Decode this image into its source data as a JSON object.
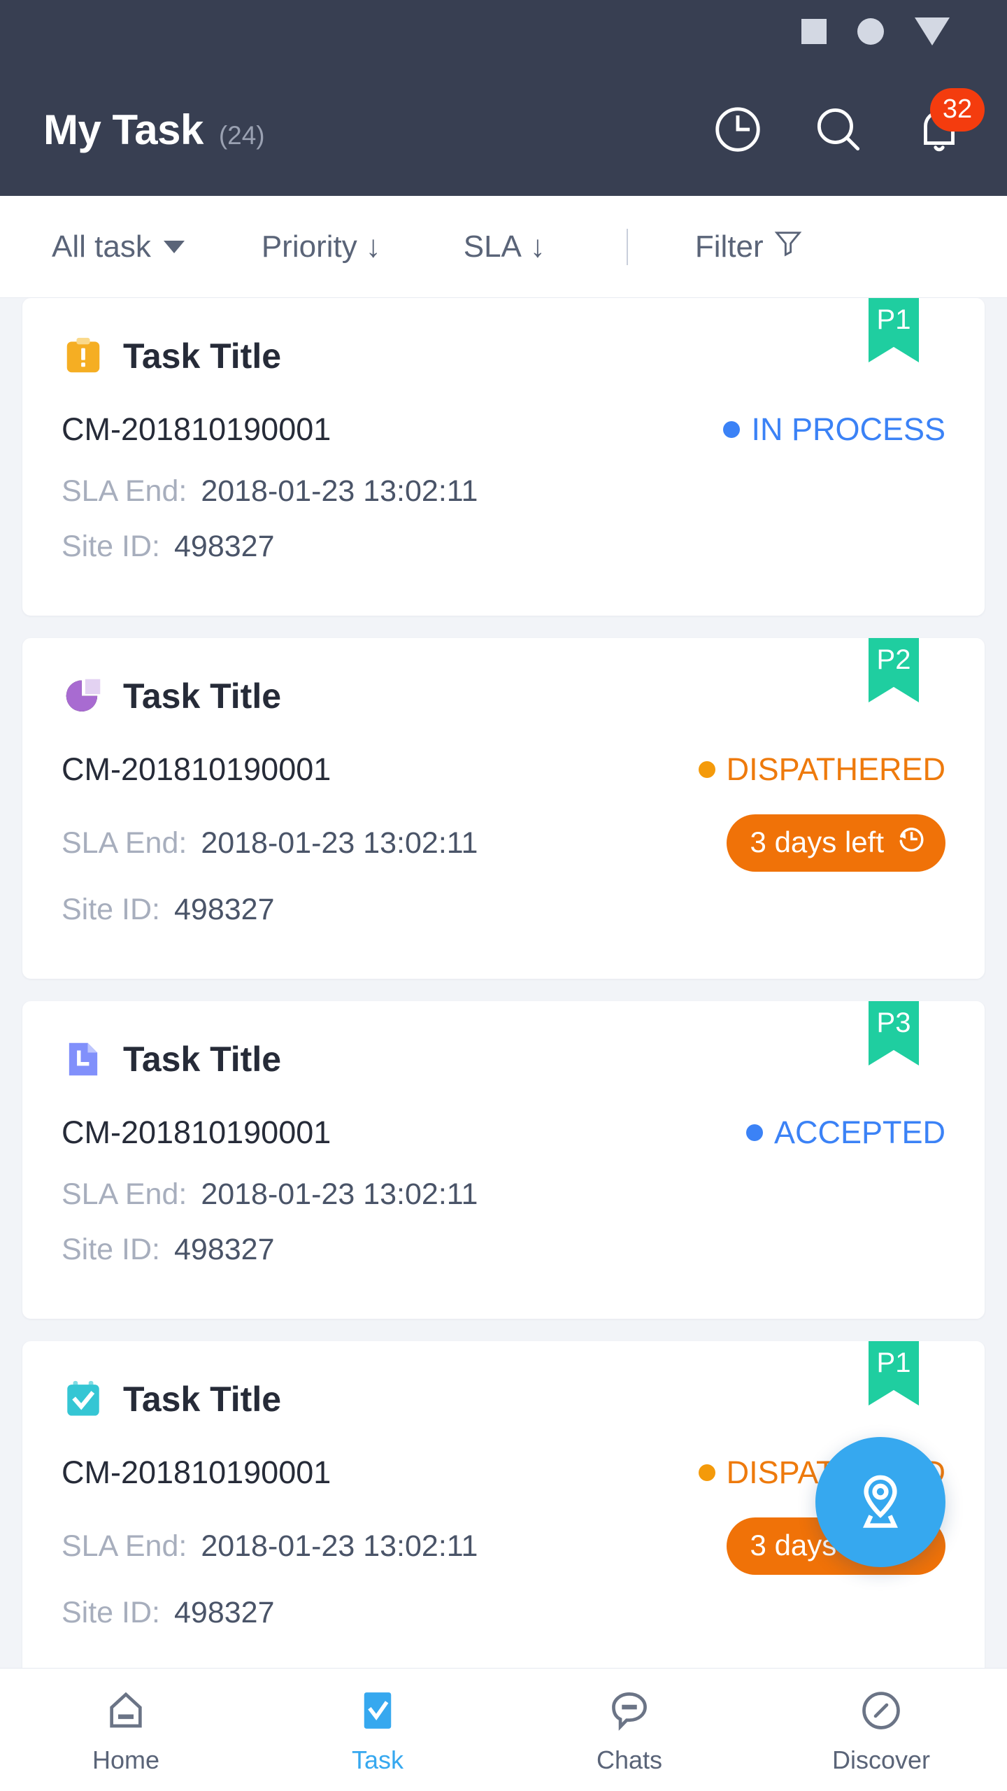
{
  "colors": {
    "header_bg": "#383F52",
    "page_bg": "#F2F4F8",
    "accent_blue": "#36A8EF",
    "status_blue": "#3B82F6",
    "status_orange": "#EE7A0C",
    "pill_orange": "#F07208",
    "flag_green": "#1FCEA0",
    "badge_red": "#F43C0E"
  },
  "statusbar": {
    "icons": [
      "square-icon",
      "circle-icon",
      "triangle-down-icon"
    ]
  },
  "header": {
    "title": "My Task",
    "count": "(24)",
    "actions": [
      {
        "name": "history-clock-icon"
      },
      {
        "name": "search-icon"
      },
      {
        "name": "notification-bell-icon",
        "badge": "32"
      }
    ]
  },
  "filterbar": {
    "all_task": "All task",
    "priority": "Priority",
    "priority_arrow": "↓",
    "sla": "SLA",
    "sla_arrow": "↓",
    "filter": "Filter"
  },
  "labels": {
    "sla_end": "SLA End:",
    "site_id": "Site ID:"
  },
  "tasks": [
    {
      "icon": "clipboard-alert-icon",
      "title": "Task Title",
      "priority": "P1",
      "task_id": "CM-201810190001",
      "status": "IN PROCESS",
      "status_color": "blue",
      "sla_end": "2018-01-23 13:02:11",
      "site_id": "498327",
      "countdown": null
    },
    {
      "icon": "pie-chart-icon",
      "title": "Task Title",
      "priority": "P2",
      "task_id": "CM-201810190001",
      "status": "DISPATHERED",
      "status_color": "orange",
      "sla_end": "2018-01-23 13:02:11",
      "site_id": "498327",
      "countdown": "3 days left"
    },
    {
      "icon": "document-icon",
      "title": "Task Title",
      "priority": "P3",
      "task_id": "CM-201810190001",
      "status": "ACCEPTED",
      "status_color": "blue",
      "sla_end": "2018-01-23 13:02:11",
      "site_id": "498327",
      "countdown": null
    },
    {
      "icon": "calendar-check-icon",
      "title": "Task Title",
      "priority": "P1",
      "task_id": "CM-201810190001",
      "status": "DISPATHERED",
      "status_color": "orange",
      "sla_end": "2018-01-23 13:02:11",
      "site_id": "498327",
      "countdown": "3 days left"
    }
  ],
  "fab": {
    "name": "location-pin-icon"
  },
  "bottomnav": {
    "items": [
      {
        "label": "Home",
        "icon": "home-icon",
        "active": false
      },
      {
        "label": "Task",
        "icon": "task-check-icon",
        "active": true
      },
      {
        "label": "Chats",
        "icon": "chat-bubble-icon",
        "active": false
      },
      {
        "label": "Discover",
        "icon": "compass-icon",
        "active": false
      }
    ]
  }
}
